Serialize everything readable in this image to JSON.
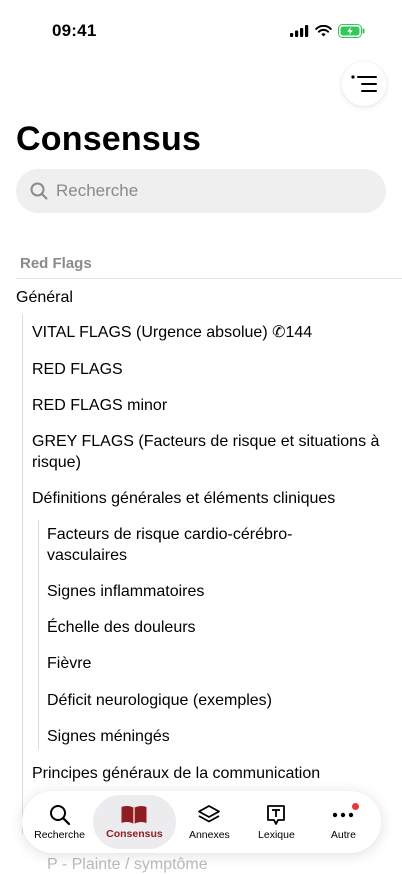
{
  "status": {
    "time": "09:41"
  },
  "header": {
    "title": "Consensus"
  },
  "search": {
    "placeholder": "Recherche"
  },
  "section": {
    "title": "Red Flags"
  },
  "toc": {
    "general": "Général",
    "items": [
      "VITAL FLAGS (Urgence absolue) ✆144",
      "RED FLAGS",
      "RED FLAGS minor",
      "GREY FLAGS (Facteurs de risque et situations à risque)",
      "Définitions générales et éléments cliniques",
      "Facteurs de risque cardio-cérébro-vasculaires",
      "Signes inflammatoires",
      "Échelle des douleurs",
      "Fièvre",
      "Déficit neurologique (exemples)",
      "Signes méningés",
      "Principes généraux de la communication",
      "P - Plainte / symptôme"
    ]
  },
  "tabs": [
    {
      "label": "Recherche"
    },
    {
      "label": "Consensus"
    },
    {
      "label": "Annexes"
    },
    {
      "label": "Lexique"
    },
    {
      "label": "Autre"
    }
  ],
  "colors": {
    "accent": "#8f1e24",
    "badge": "#e8373a",
    "battery": "#34c759"
  }
}
